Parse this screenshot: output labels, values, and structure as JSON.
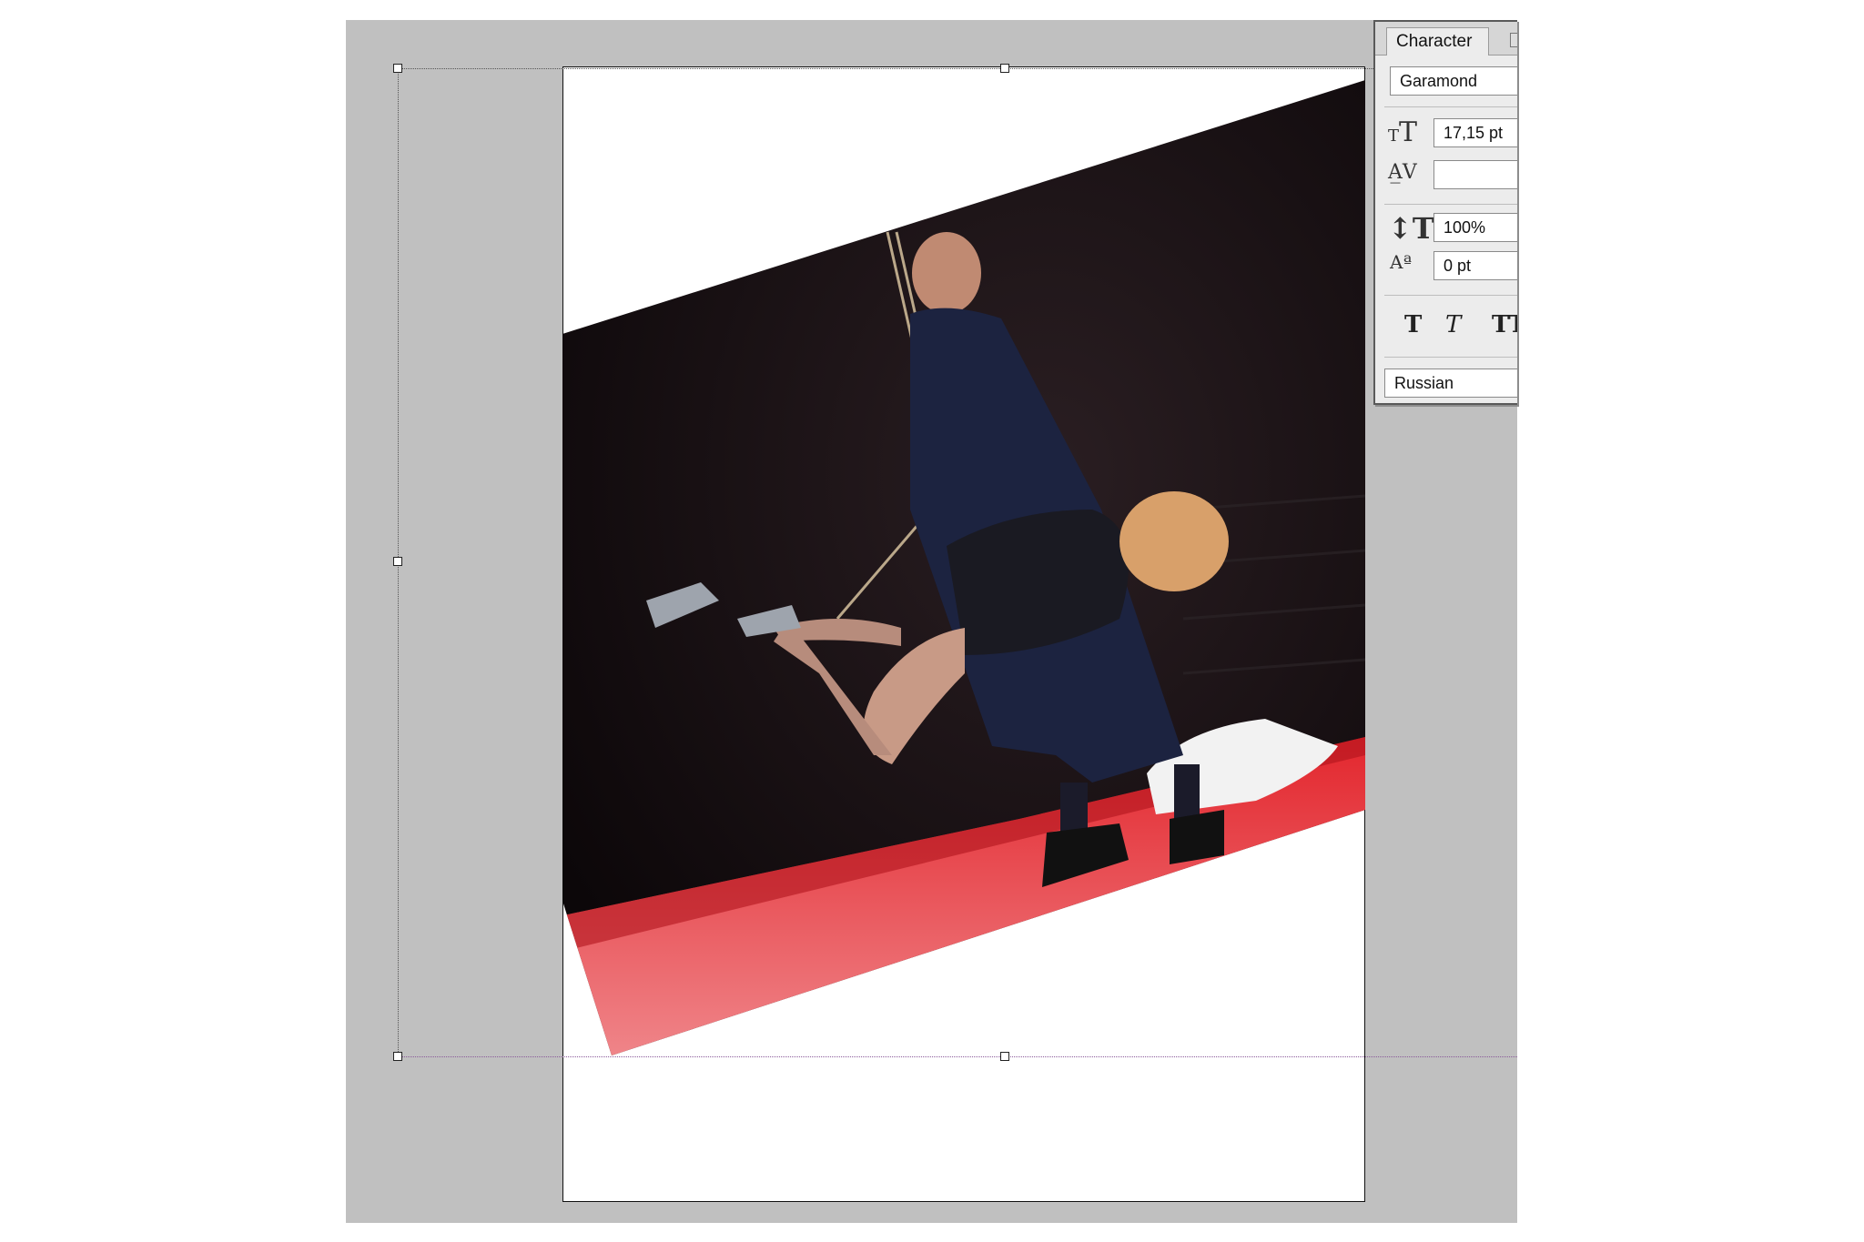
{
  "character_panel": {
    "tab_label": "Character",
    "font_family": "Garamond",
    "font_size": "17,15 pt",
    "tracking": "",
    "vertical_scale": "100%",
    "baseline_shift": "0 pt",
    "language": "Russian",
    "style_buttons": [
      "T",
      "T",
      "TT"
    ]
  },
  "colors": {
    "workspace": "#c0c0c0",
    "floor_red": "#d41c24",
    "background_dark": "#120c10"
  },
  "icons": [
    "font-size-icon",
    "tracking-icon",
    "vertical-scale-icon",
    "baseline-shift-icon",
    "faux-bold-icon",
    "faux-italic-icon",
    "all-caps-icon"
  ]
}
